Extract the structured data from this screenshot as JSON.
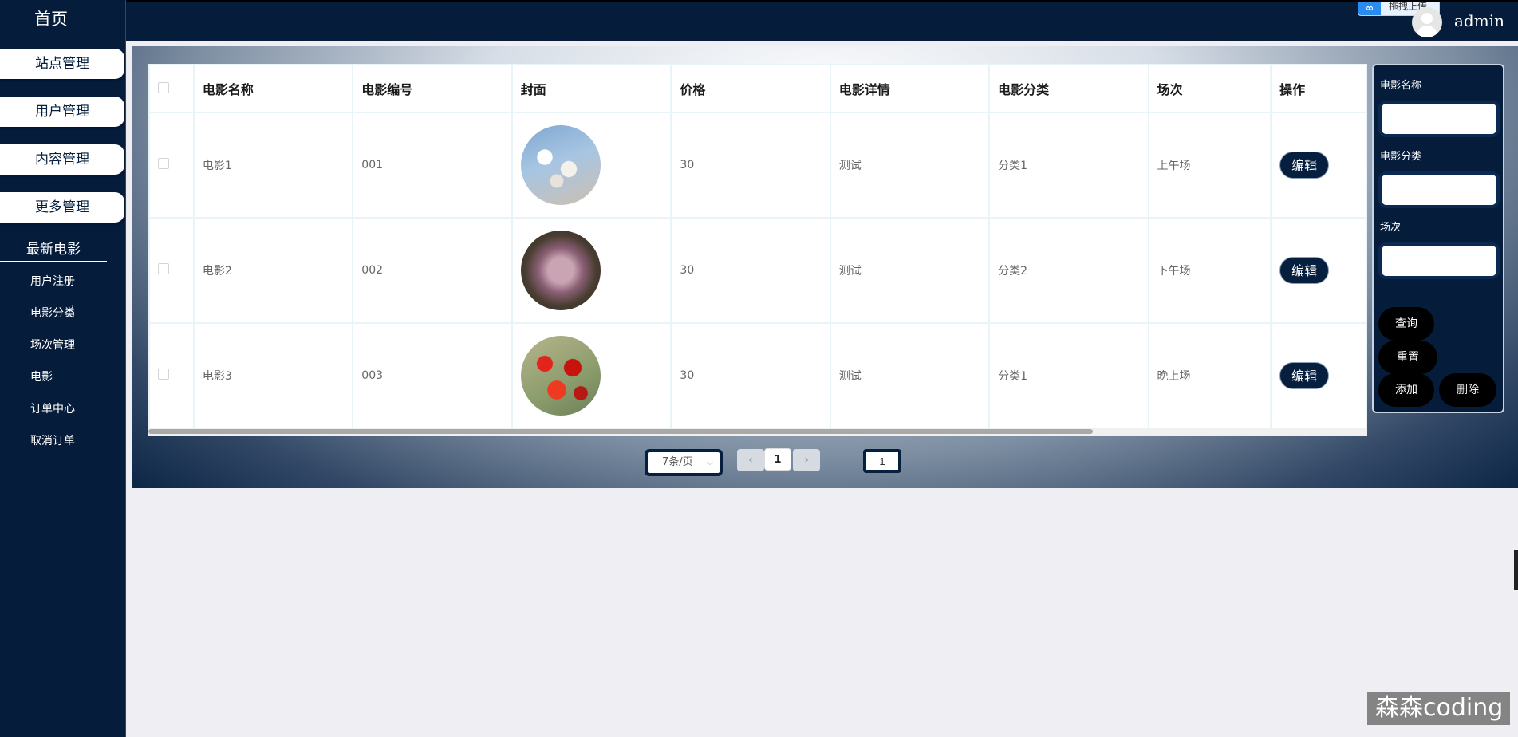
{
  "header": {
    "username": "admin",
    "drag_upload": "拖拽上传"
  },
  "sidebar": {
    "home": "首页",
    "menu": [
      "站点管理",
      "用户管理",
      "内容管理",
      "更多管理"
    ],
    "section_title": "最新电影",
    "sub_items": [
      "用户注册",
      "电影分类",
      "场次管理",
      "电影",
      "订单中心",
      "取消订单"
    ]
  },
  "table": {
    "columns": [
      "电影名称",
      "电影编号",
      "封面",
      "价格",
      "电影详情",
      "电影分类",
      "场次",
      "操作"
    ],
    "rows": [
      {
        "name": "电影1",
        "code": "001",
        "price": "30",
        "detail": "测试",
        "category": "分类1",
        "session": "上午场",
        "action": "编辑"
      },
      {
        "name": "电影2",
        "code": "002",
        "price": "30",
        "detail": "测试",
        "category": "分类2",
        "session": "下午场",
        "action": "编辑"
      },
      {
        "name": "电影3",
        "code": "003",
        "price": "30",
        "detail": "测试",
        "category": "分类1",
        "session": "晚上场",
        "action": "编辑"
      }
    ]
  },
  "pagination": {
    "page_size": "7条/页",
    "prev": "‹",
    "current_page": "1",
    "next": "›",
    "goto_value": "1"
  },
  "search": {
    "name_label": "电影名称",
    "category_label": "电影分类",
    "session_label": "场次",
    "buttons": {
      "query": "查询",
      "reset": "重置",
      "add": "添加",
      "delete": "删除"
    }
  },
  "watermark": "森森coding"
}
